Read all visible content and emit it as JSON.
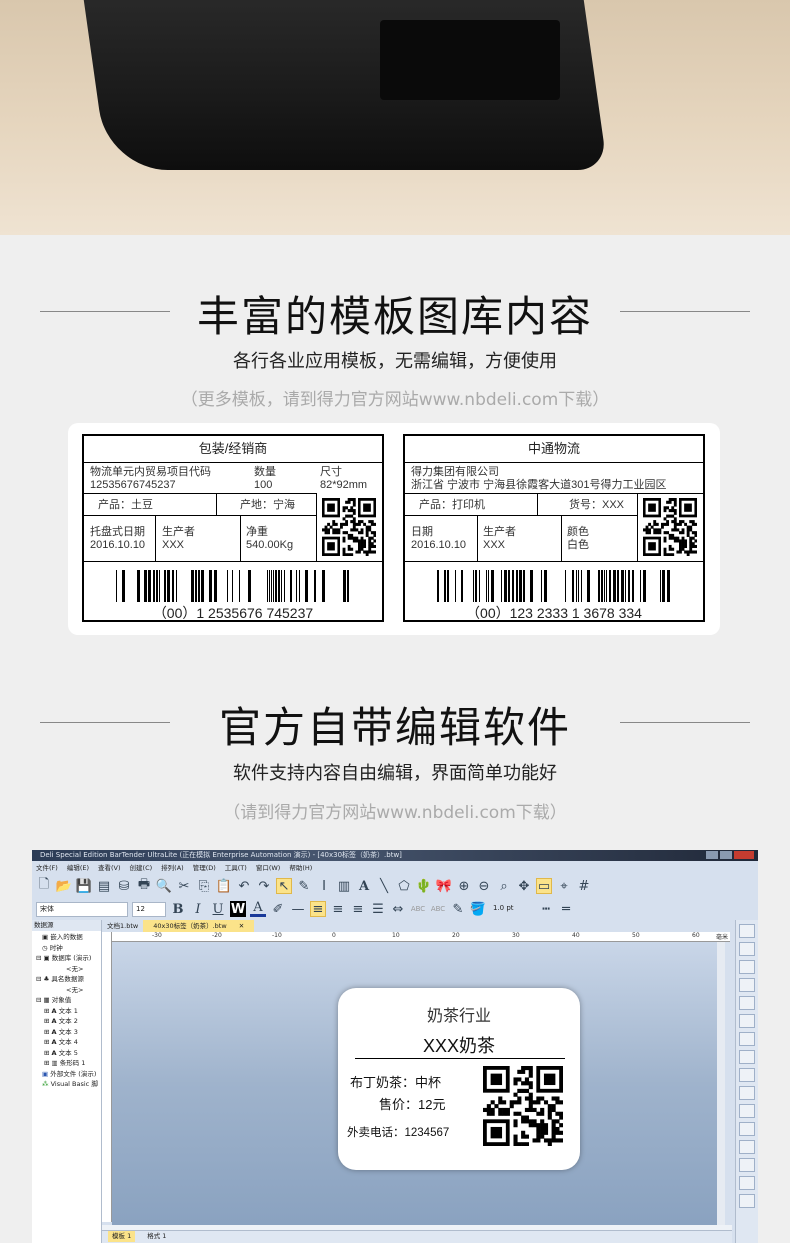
{
  "section1": {
    "title": "丰富的模板图库内容",
    "subtitle": "各行各业应用模板，无需编辑，方便使用",
    "note": "（更多模板，请到得力官方网站www.nbdeli.com下载）"
  },
  "label1": {
    "header": "包装/经销商",
    "code_label": "物流单元内贸易项目代码",
    "code_value": "12535676745237",
    "qty_label": "数量",
    "qty_value": "100",
    "size_label": "尺寸",
    "size_value": "82*92mm",
    "product": "产品：土豆",
    "origin": "产地：宁海",
    "date_label": "托盘式日期",
    "date_value": "2016.10.10",
    "maker_label": "生产者",
    "maker_value": "XXX",
    "weight_label": "净重",
    "weight_value": "540.00Kg",
    "barcode_text": "（00）1 2535676 745237"
  },
  "label2": {
    "header": "中通物流",
    "company": "得力集团有限公司",
    "address": "浙江省 宁波市 宁海县徐霞客大道301号得力工业园区",
    "product": "产品：打印机",
    "item_no": "货号：XXX",
    "date_label": "日期",
    "date_value": "2016.10.10",
    "maker_label": "生产者",
    "maker_value": "XXX",
    "color_label": "颜色",
    "color_value": "白色",
    "barcode_text": "（00）123 2333 1 3678 334"
  },
  "section2": {
    "title": "官方自带编辑软件",
    "subtitle": "软件支持内容自由编辑，界面简单功能好",
    "note": "（请到得力官方网站www.nbdeli.com下载）"
  },
  "software": {
    "window_title": "Deli Special Edition BarTender UltraLite (正在模拟 Enterprise Automation 演示) - [40x30标签（奶茶）.btw]",
    "menu": [
      "文件(F)",
      "编辑(E)",
      "查看(V)",
      "创建(C)",
      "排列(A)",
      "管理(D)",
      "工具(T)",
      "窗口(W)",
      "帮助(H)"
    ],
    "font_name": "宋体",
    "font_size": "12",
    "line_width": "1.0 pt",
    "panel_title": "数据源",
    "tree": [
      "嵌入的数据",
      "时钟",
      "数据库 (演示)",
      "<无>",
      "具名数据源",
      "<无>",
      "对象值",
      "文本 1",
      "文本 2",
      "文本 3",
      "文本 4",
      "文本 5",
      "条形码 1",
      "外部文件 (演示)",
      "Visual Basic 脚"
    ],
    "tabs": [
      "文档1.btw",
      "40x30标签（奶茶）.btw"
    ],
    "ruler_ticks": [
      "-30",
      "-20",
      "-10",
      "0",
      "10",
      "20",
      "30",
      "40",
      "50",
      "60"
    ],
    "ruler_unit": "毫米",
    "bottom_tabs": [
      "模板 1",
      "格式 1"
    ],
    "label": {
      "industry": "奶茶行业",
      "shop": "XXX奶茶",
      "item": "布丁奶茶：中杯",
      "price": "售价：12元",
      "phone": "外卖电话：1234567"
    },
    "accent_color": "#fbe38a"
  }
}
